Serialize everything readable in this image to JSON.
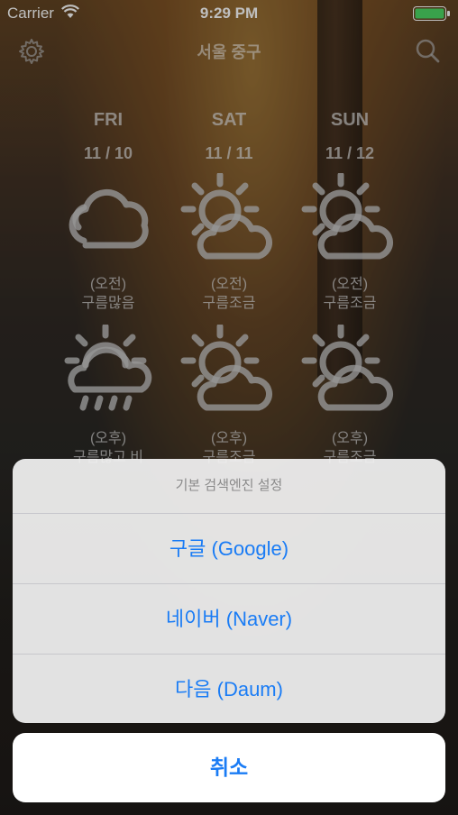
{
  "status_bar": {
    "carrier": "Carrier",
    "time": "9:29 PM"
  },
  "nav": {
    "title": "서울 중구",
    "left_icon": "gear-icon",
    "right_icon": "search-icon"
  },
  "forecast": [
    {
      "day": "FRI",
      "date": "11 / 10",
      "am_icon": "cloudy-icon",
      "am_label": "(오전)",
      "am_condition": "구름많음",
      "pm_icon": "sun-cloud-rain-icon",
      "pm_label": "(오후)",
      "pm_condition": "구름많고 비"
    },
    {
      "day": "SAT",
      "date": "11 / 11",
      "am_icon": "partly-cloudy-icon",
      "am_label": "(오전)",
      "am_condition": "구름조금",
      "pm_icon": "partly-cloudy-icon",
      "pm_label": "(오후)",
      "pm_condition": "구름조금"
    },
    {
      "day": "SUN",
      "date": "11 / 12",
      "am_icon": "partly-cloudy-icon",
      "am_label": "(오전)",
      "am_condition": "구름조금",
      "pm_icon": "partly-cloudy-icon",
      "pm_label": "(오후)",
      "pm_condition": "구름조금"
    }
  ],
  "action_sheet": {
    "title": "기본 검색엔진 설정",
    "options": [
      "구글 (Google)",
      "네이버 (Naver)",
      "다음 (Daum)"
    ],
    "cancel": "취소"
  },
  "colors": {
    "accent": "#1a7cf5",
    "battery": "#4cd964"
  }
}
